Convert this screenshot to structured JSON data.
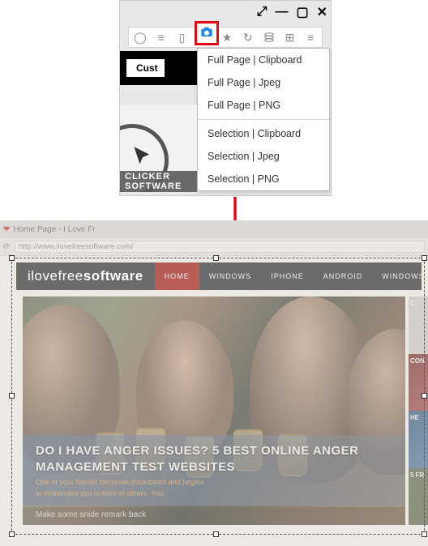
{
  "toolbar": {
    "menu": {
      "items_top": [
        "Full Page | Clipboard",
        "Full Page | Jpeg",
        "Full Page | PNG"
      ],
      "items_bottom": [
        "Selection | Clipboard",
        "Selection | Jpeg",
        "Selection | PNG"
      ]
    },
    "customize_label": "Cust",
    "preview_caption": "CLICKER SOFTWARE"
  },
  "browser": {
    "tab_title": "Home Page - I Love Fr",
    "url": "http://www.ilovefreesoftware.com/",
    "logo_thin": "ilove",
    "logo_mid": "free",
    "logo_bold": "software",
    "nav": [
      "HOME",
      "WINDOWS",
      "IPHONE",
      "ANDROID",
      "WINDOWS"
    ],
    "hero_title": "DO I HAVE ANGER ISSUES? 5 BEST ONLINE ANGER MANAGEMENT TEST WEBSITES",
    "hero_sub1": "One of your friends becomes intoxicated and begins",
    "hero_sub2": "to embarrass you in front of others. You:",
    "hero_footer": "Make some snide remark back",
    "side_labels": [
      "C",
      "CON",
      "HE",
      "5 FR"
    ]
  }
}
